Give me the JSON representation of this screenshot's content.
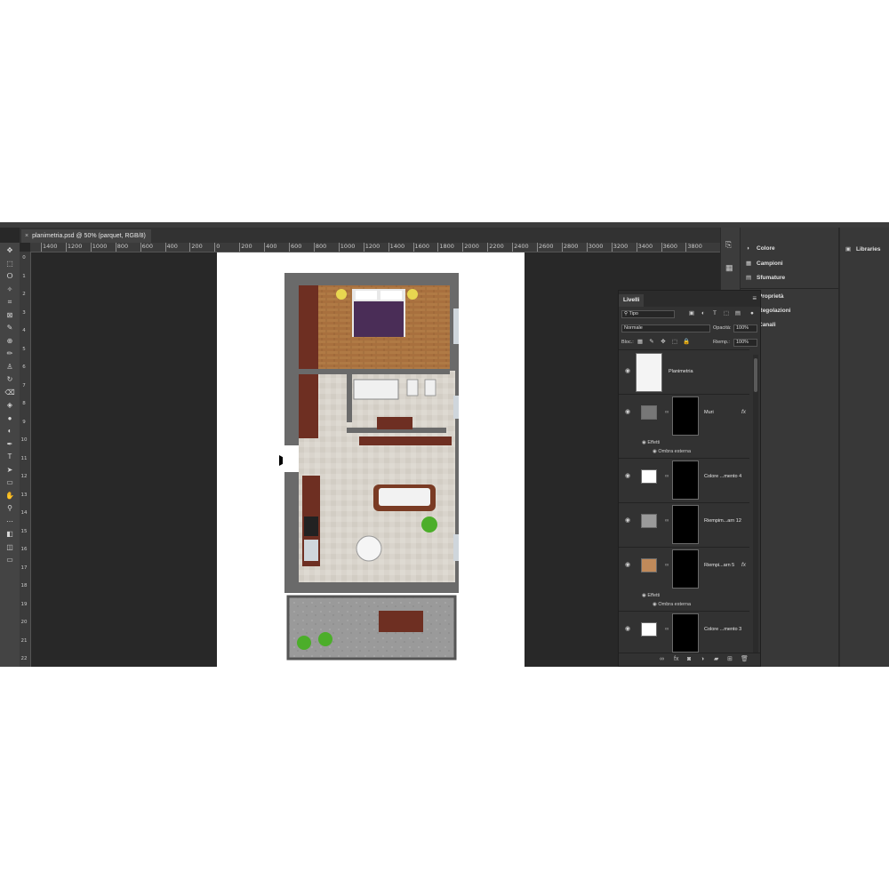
{
  "document": {
    "tab_title": "planimetria.psd @ 50% (parquet, RGB/8)",
    "close_symbol": "×"
  },
  "ruler": {
    "h_ticks": [
      "1400",
      "1200",
      "1000",
      "800",
      "600",
      "400",
      "200",
      "0",
      "200",
      "400",
      "600",
      "800",
      "1000",
      "1200",
      "1400",
      "1600",
      "1800",
      "2000",
      "2200",
      "2400",
      "2600",
      "2800",
      "3000",
      "3200",
      "3400",
      "3600",
      "3800"
    ],
    "v_labels": [
      "0",
      "1",
      "2",
      "3",
      "4",
      "5",
      "6",
      "7",
      "8",
      "9",
      "10",
      "11",
      "12",
      "13",
      "14",
      "15",
      "16",
      "17",
      "18",
      "19",
      "20",
      "21",
      "22"
    ]
  },
  "tools": [
    "move-tool",
    "marquee-tool",
    "lasso-tool",
    "magic-wand-tool",
    "crop-tool",
    "frame-tool",
    "eyedropper-tool",
    "healing-tool",
    "brush-tool",
    "stamp-tool",
    "history-brush-tool",
    "eraser-tool",
    "gradient-tool",
    "blur-tool",
    "dodge-tool",
    "pen-tool",
    "type-tool",
    "path-select-tool",
    "shape-tool",
    "hand-tool",
    "zoom-tool",
    "more-tools",
    "color-swatches",
    "quick-mask",
    "screen-mode"
  ],
  "tool_glyphs": [
    "✥",
    "⬚",
    "ⵔ",
    "✧",
    "⌗",
    "⊠",
    "✎",
    "⊕",
    "✏",
    "♙",
    "↻",
    "⌫",
    "◈",
    "●",
    "◐",
    "✒",
    "T",
    "➤",
    "▭",
    "✋",
    "⚲",
    "⋯",
    "◧",
    "◫",
    "▭"
  ],
  "panels": {
    "colore": "Colore",
    "campioni": "Campioni",
    "sfumature": "Sfumature",
    "proprieta": "Proprietà",
    "regolazioni": "Regolazioni",
    "canali": "Canali",
    "libraries": "Libraries"
  },
  "layers_panel": {
    "title": "Livelli",
    "filter_kind": "Tipo",
    "blend_mode": "Normale",
    "opacity_label": "Opacità:",
    "opacity_value": "100%",
    "lock_label": "Bloc.:",
    "fill_label": "Riemp.:",
    "fill_value": "100%",
    "layers": [
      {
        "name": "Planimetria",
        "thumb_color": "#f4f4f4",
        "has_mask": false,
        "fx": ""
      },
      {
        "name": "Muri",
        "thumb_color": "#777777",
        "has_mask": true,
        "fx": "fx",
        "effects_label": "Effetti",
        "effect": "Ombra esterna"
      },
      {
        "name": "Colore ...mento 4",
        "thumb_color": "#ffffff",
        "has_mask": true,
        "fx": ""
      },
      {
        "name": "Riempim...arn 12",
        "thumb_color": "#9a9a9a",
        "has_mask": true,
        "fx": ""
      },
      {
        "name": "Riempi...arn 5",
        "thumb_color": "#c08a5a",
        "has_mask": true,
        "fx": "fx",
        "effects_label": "Effetti",
        "effect": "Ombra esterna"
      },
      {
        "name": "Colore ...mento 3",
        "thumb_color": "#ffffff",
        "has_mask": true,
        "fx": ""
      }
    ]
  },
  "colors": {
    "app_bg": "#282828",
    "panel_bg": "#323232",
    "wall": "#6a6a6a",
    "parquet": "#a8703e",
    "bedspread": "#4a2d57",
    "tile_floor": "#d9d4cc",
    "wardrobe": "#6e2f22",
    "terrace": "#9a9a9a",
    "plant": "#4cae2a"
  }
}
